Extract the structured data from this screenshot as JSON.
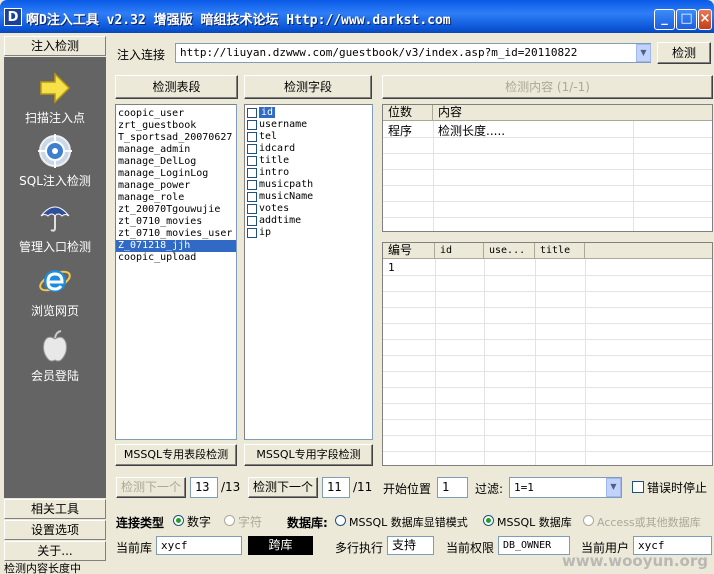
{
  "window": {
    "icon_letter": "D",
    "title": "啊D注入工具 v2.32 增强版 暗组技术论坛 Http://www.darkst.com",
    "min": "_",
    "max": "□",
    "close": "×"
  },
  "sidebar": {
    "top_label": "注入检测",
    "items": [
      {
        "label": "扫描注入点",
        "icon": "arrow-icon"
      },
      {
        "label": "SQL注入检测",
        "icon": "target-icon"
      },
      {
        "label": "管理入口检测",
        "icon": "umbrella-icon"
      },
      {
        "label": "浏览网页",
        "icon": "ie-icon"
      },
      {
        "label": "会员登陆",
        "icon": "apple-icon"
      }
    ],
    "bottom_buttons": [
      "相关工具",
      "设置选项",
      "关于..."
    ]
  },
  "inject": {
    "label": "注入连接",
    "url": "http://liuyan.dzwww.com/guestbook/v3/index.asp?m_id=20110822",
    "detect_btn": "检测"
  },
  "tables_panel": {
    "button": "检测表段",
    "items": [
      "coopic_user",
      "zrt_guestbook",
      "T_sportsad_20070627",
      "manage_admin",
      "manage_DelLog",
      "manage_LoginLog",
      "manage_power",
      "manage_role",
      "zt_20070Tgouwujie",
      "zt_0710_movies",
      "zt_0710_movies_user",
      "Z_071218_jjh",
      "coopic_upload"
    ],
    "selected_index": 11,
    "mssql_btn": "MSSQL专用表段检测"
  },
  "fields_panel": {
    "button": "检测字段",
    "items": [
      "id",
      "username",
      "tel",
      "idcard",
      "title",
      "intro",
      "musicpath",
      "musicName",
      "votes",
      "addtime",
      "ip"
    ],
    "selected_index": 0,
    "mssql_btn": "MSSQL专用字段检测"
  },
  "content": {
    "button": "检测内容 (1/-1)",
    "top_grid": {
      "headers": [
        "位数",
        "内容"
      ],
      "rows": [
        [
          "程序",
          "检测长度....."
        ]
      ]
    },
    "bottom_grid": {
      "headers": [
        "编号",
        "id",
        "use...",
        "title"
      ],
      "rows": [
        [
          "1",
          "",
          "",
          ""
        ]
      ]
    }
  },
  "paging": {
    "prev_next1": "检测下一个",
    "count1": "13",
    "total1": "/13",
    "next2": "检测下一个",
    "count2": "11",
    "total2": "/11",
    "start_label": "开始位置",
    "start_value": "1",
    "filter_label": "过滤:",
    "filter_value": "1=1",
    "stop_on_error": "错误时停止"
  },
  "conn": {
    "type_label": "连接类型",
    "opt_number": "数字",
    "opt_char": "字符",
    "db_label": "数据库:",
    "db_opt1": "MSSQL 数据库显错模式",
    "db_opt2": "MSSQL 数据库",
    "db_opt3": "Access或其他数据库"
  },
  "info": {
    "cur_db_label": "当前库",
    "cur_db": "xycf",
    "cross_db": "跨库",
    "multi_label": "多行执行",
    "multi_value": "支持",
    "perm_label": "当前权限",
    "perm_value": "DB_OWNER",
    "user_label": "当前用户",
    "user_value": "xycf"
  },
  "status": "检测内容长度中",
  "watermark": "www.wooyun.org"
}
